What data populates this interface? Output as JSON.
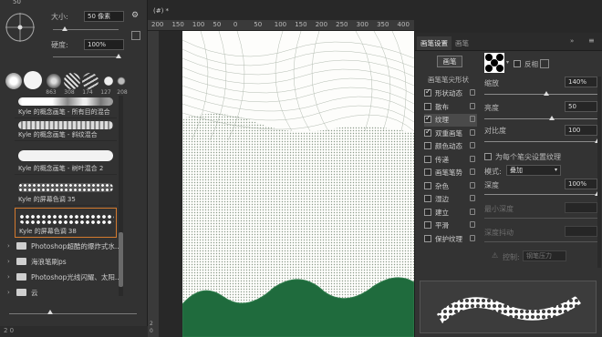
{
  "document": {
    "tab_label": "(#) *",
    "ruler_marks": [
      "200",
      "150",
      "100",
      "50",
      "0",
      "50",
      "100",
      "150",
      "200",
      "250",
      "300",
      "350",
      "400"
    ],
    "vertical_ruler_marks": [
      "2",
      "0"
    ]
  },
  "brush_presets": {
    "top_marker": "50",
    "size_label": "大小:",
    "size_value": "50 像素",
    "hardness_label": "硬度:",
    "hardness_value": "100%",
    "size_slider_fraction": 0.18,
    "hardness_slider_fraction": 1.0,
    "tips": [
      {
        "num": "863"
      },
      {
        "num": "308"
      },
      {
        "num": "174"
      },
      {
        "num": "127"
      },
      {
        "num": "208"
      }
    ],
    "items": [
      {
        "name": "Kyle 的概念画笔 - 所有目的混合"
      },
      {
        "name": "Kyle 的概念画笔 - 斜纹混合"
      },
      {
        "name": "Kyle 的概念画笔 - 树叶混合 2"
      },
      {
        "name": "Kyle 的屏幕色调 35"
      },
      {
        "name": "Kyle 的屏幕色调 38",
        "selected": true
      }
    ],
    "folders": [
      {
        "name": "Photoshop超酷的爆炸式水..."
      },
      {
        "name": "海浪笔刷ps"
      },
      {
        "name": "Photoshop光线闪耀、太阳..."
      },
      {
        "name": "云"
      }
    ],
    "status_text": "2 0"
  },
  "brush_settings": {
    "tabs": [
      "画笔设置",
      "画笔"
    ],
    "brush_button": "画笔",
    "tip_shape_heading": "画笔笔尖形状",
    "invert_label": "反相",
    "options": [
      {
        "label": "形状动态",
        "checked": true
      },
      {
        "label": "散布",
        "checked": false
      },
      {
        "label": "纹理",
        "checked": true,
        "active": true
      },
      {
        "label": "双重画笔",
        "checked": true
      },
      {
        "label": "颜色动态",
        "checked": false
      },
      {
        "label": "传递",
        "checked": false
      },
      {
        "label": "画笔笔势",
        "checked": false
      },
      {
        "label": "杂色",
        "checked": false
      },
      {
        "label": "湿边",
        "checked": false
      },
      {
        "label": "建立",
        "checked": false
      },
      {
        "label": "平滑",
        "checked": false
      },
      {
        "label": "保护纹理",
        "checked": false
      }
    ],
    "scale_label": "缩放",
    "scale_value": "140%",
    "scale_fraction": 0.55,
    "brightness_label": "亮度",
    "brightness_value": "50",
    "brightness_fraction": 0.6,
    "contrast_label": "对比度",
    "contrast_value": "100",
    "contrast_fraction": 1.0,
    "texture_each_tip_label": "为每个笔尖设置纹理",
    "mode_label": "模式:",
    "mode_value": "叠加",
    "depth_label": "深度",
    "depth_value": "100%",
    "depth_fraction": 1.0,
    "min_depth_label": "最小深度",
    "depth_jitter_label": "深度抖动",
    "control_label": "控制:",
    "control_value": "钢笔压力"
  },
  "colors": {
    "canvas_green": "#1f6b3d",
    "texture_line": "#9aa69a"
  }
}
